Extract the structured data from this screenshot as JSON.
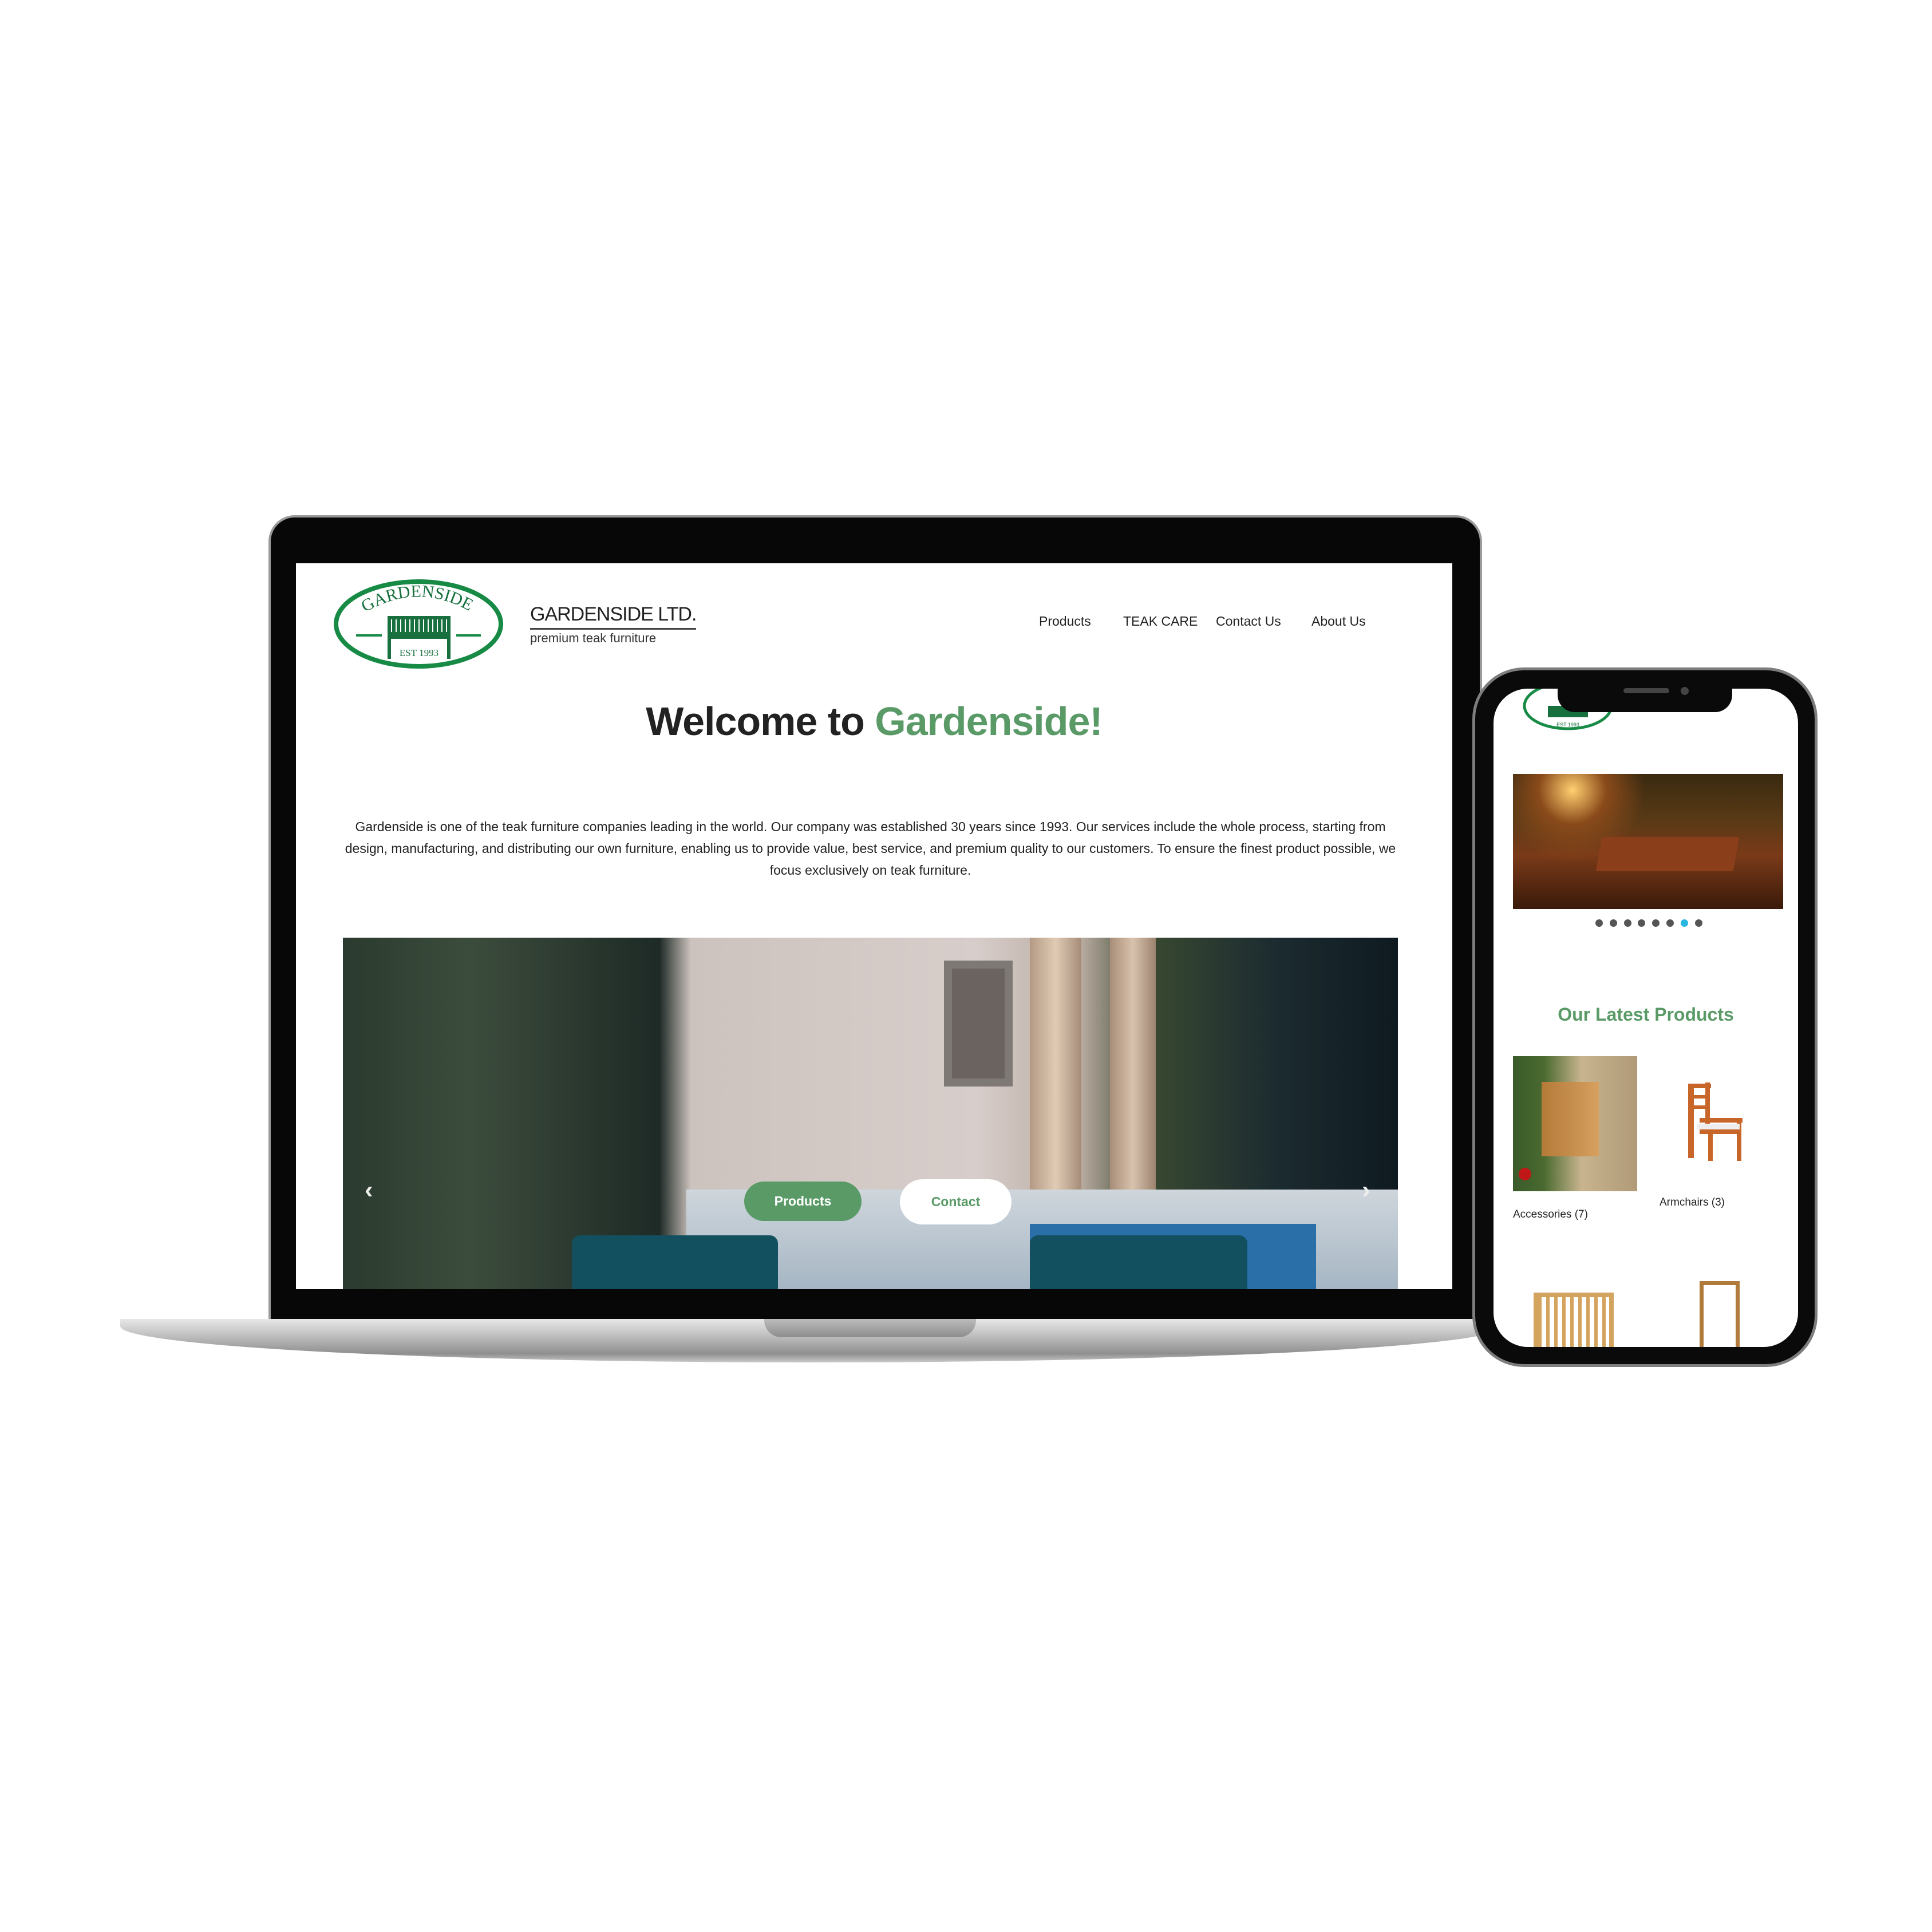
{
  "header": {
    "logo_text": "GARDENSIDE",
    "logo_est": "EST 1993",
    "brand_title": "GARDENSIDE LTD.",
    "brand_subtitle": "premium teak furniture"
  },
  "nav": [
    {
      "label": "Products"
    },
    {
      "label": "TEAK CARE"
    },
    {
      "label": "Contact Us"
    },
    {
      "label": "About Us"
    }
  ],
  "hero": {
    "heading_prefix": "Welcome to ",
    "heading_highlight": "Gardenside!",
    "paragraph": "Gardenside is one of the teak furniture companies leading in the world. Our company was established 30 years since 1993. Our services include the whole process, starting from design, manufacturing, and distributing our own furniture, enabling us to provide value, best service, and premium quality to our customers. To ensure the finest product possible, we focus exclusively on teak furniture.",
    "products_button": "Products",
    "contact_button": "Contact",
    "accent": "#5a9a67"
  },
  "mobile": {
    "slide_count": 8,
    "active_slide": 7,
    "section_title": "Our Latest Products",
    "products": [
      {
        "label": "Accessories (7)"
      },
      {
        "label": "Armchairs (3)"
      }
    ],
    "active_dot_color": "#29b6e0"
  }
}
